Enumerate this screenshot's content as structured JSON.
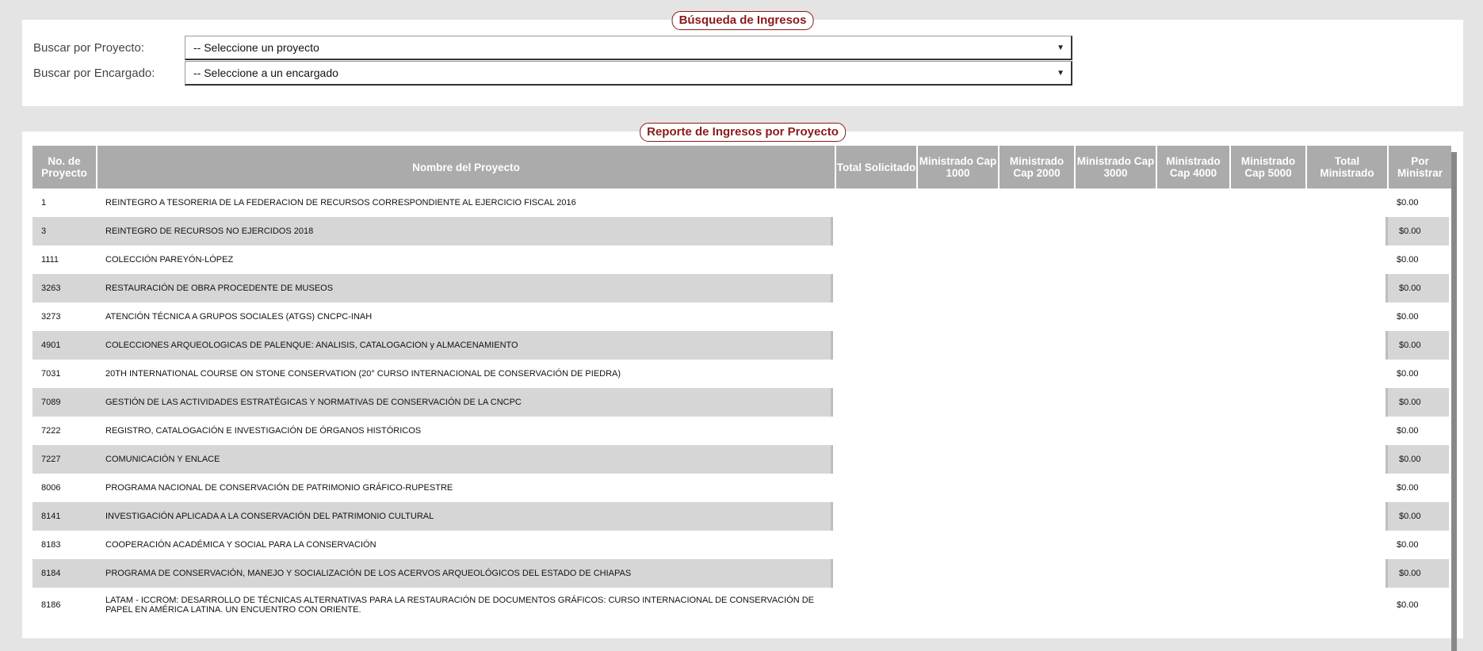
{
  "search": {
    "title": "Búsqueda de Ingresos",
    "project_label": "Buscar por Proyecto:",
    "project_value": "-- Seleccione un proyecto",
    "manager_label": "Buscar por Encargado:",
    "manager_value": "-- Seleccione a un encargado"
  },
  "report": {
    "title": "Reporte de Ingresos por Proyecto",
    "columns": [
      "No. de Proyecto",
      "Nombre del Proyecto",
      "Total Solicitado",
      "Ministrado Cap 1000",
      "Ministrado Cap 2000",
      "Ministrado Cap 3000",
      "Ministrado Cap 4000",
      "Ministrado Cap 5000",
      "Total Ministrado",
      "Por Ministrar"
    ],
    "rows": [
      {
        "no": "1",
        "name": "REINTEGRO A TESORERIA DE LA FEDERACION DE RECURSOS CORRESPONDIENTE AL EJERCICIO FISCAL 2016",
        "por_ministrar": "$0.00"
      },
      {
        "no": "3",
        "name": "REINTEGRO DE RECURSOS NO EJERCIDOS 2018",
        "por_ministrar": "$0.00"
      },
      {
        "no": "1111",
        "name": "COLECCIÓN PAREYÓN-LÓPEZ",
        "por_ministrar": "$0.00"
      },
      {
        "no": "3263",
        "name": "RESTAURACIÓN DE OBRA PROCEDENTE DE MUSEOS",
        "por_ministrar": "$0.00"
      },
      {
        "no": "3273",
        "name": "ATENCIÓN TÉCNICA A GRUPOS SOCIALES (ATGS) CNCPC-INAH",
        "por_ministrar": "$0.00"
      },
      {
        "no": "4901",
        "name": "COLECCIONES ARQUEOLOGICAS DE PALENQUE: ANALISIS, CATALOGACION y ALMACENAMIENTO",
        "por_ministrar": "$0.00"
      },
      {
        "no": "7031",
        "name": "20TH INTERNATIONAL COURSE ON STONE CONSERVATION (20° CURSO INTERNACIONAL DE CONSERVACIÓN DE PIEDRA)",
        "por_ministrar": "$0.00"
      },
      {
        "no": "7089",
        "name": "GESTIÓN DE LAS ACTIVIDADES ESTRATÉGICAS Y NORMATIVAS DE CONSERVACIÓN DE LA CNCPC",
        "por_ministrar": "$0.00"
      },
      {
        "no": "7222",
        "name": "REGISTRO, CATALOGACIÓN E INVESTIGACIÓN DE ÓRGANOS HISTÓRICOS",
        "por_ministrar": "$0.00"
      },
      {
        "no": "7227",
        "name": "COMUNICACIÓN Y ENLACE",
        "por_ministrar": "$0.00"
      },
      {
        "no": "8006",
        "name": "PROGRAMA NACIONAL DE CONSERVACIÓN DE PATRIMONIO GRÁFICO-RUPESTRE",
        "por_ministrar": "$0.00"
      },
      {
        "no": "8141",
        "name": "INVESTIGACIÓN APLICADA A LA CONSERVACIÓN DEL PATRIMONIO CULTURAL",
        "por_ministrar": "$0.00"
      },
      {
        "no": "8183",
        "name": "COOPERACIÓN ACADÉMICA Y SOCIAL PARA LA CONSERVACIÓN",
        "por_ministrar": "$0.00"
      },
      {
        "no": "8184",
        "name": "PROGRAMA DE CONSERVACIÓN, MANEJO Y SOCIALIZACIÓN DE LOS ACERVOS ARQUEOLÓGICOS DEL ESTADO DE CHIAPAS",
        "por_ministrar": "$0.00"
      },
      {
        "no": "8186",
        "name": "LATAM - ICCROM: DESARROLLO DE TÉCNICAS ALTERNATIVAS PARA LA RESTAURACIÓN DE DOCUMENTOS GRÁFICOS: CURSO INTERNACIONAL DE CONSERVACIÓN DE PAPEL EN AMÉRICA LATINA. UN ENCUENTRO CON ORIENTE.",
        "por_ministrar": "$0.00"
      }
    ]
  }
}
